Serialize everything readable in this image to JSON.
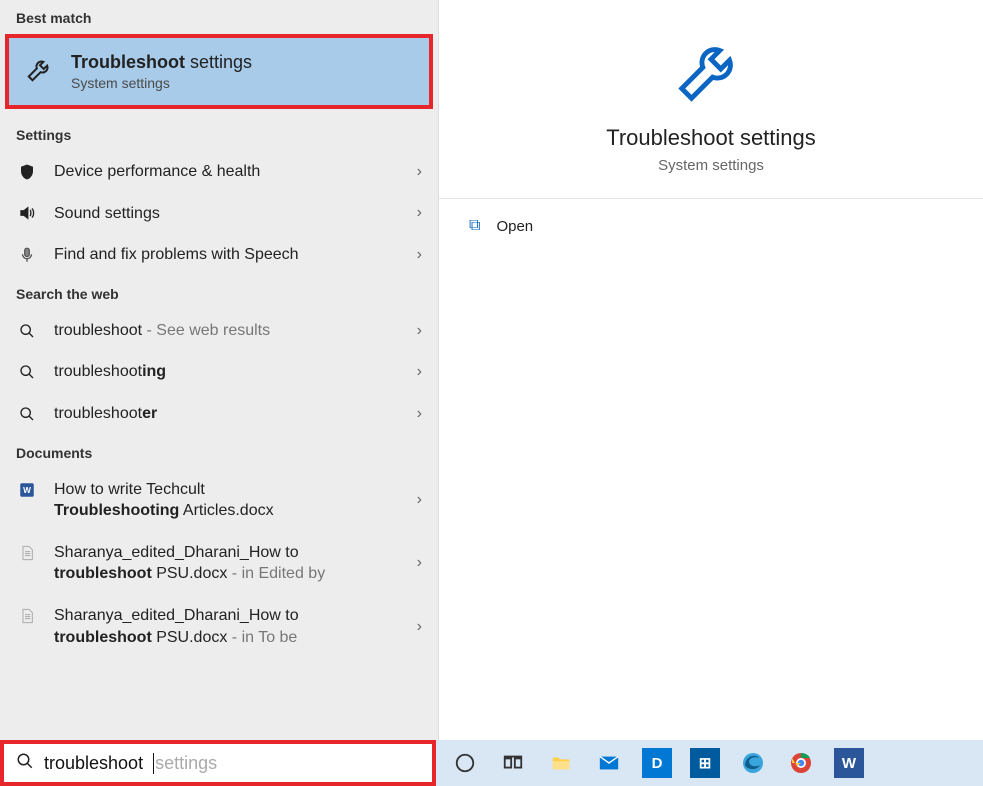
{
  "sections": {
    "best_match": "Best match",
    "settings": "Settings",
    "web": "Search the web",
    "documents": "Documents"
  },
  "best_match_item": {
    "title_bold": "Troubleshoot",
    "title_rest": " settings",
    "subtitle": "System settings"
  },
  "settings_items": [
    {
      "label": "Device performance & health"
    },
    {
      "label": "Sound settings"
    },
    {
      "label": "Find and fix problems with Speech"
    }
  ],
  "web_items": [
    {
      "prefix": "troubleshoot",
      "bold": "",
      "suffix": " - See web results",
      "suffix_faint": true
    },
    {
      "prefix": "troubleshoot",
      "bold": "ing",
      "suffix": ""
    },
    {
      "prefix": "troubleshoot",
      "bold": "er",
      "suffix": ""
    }
  ],
  "doc_items": [
    {
      "line1_pre": "How to write Techcult ",
      "line1_bold": "",
      "line2_bold": "Troubleshooting",
      "line2_post": " Articles.docx",
      "meta": ""
    },
    {
      "line1_pre": "Sharanya_edited_Dharani_How to ",
      "line1_bold": "",
      "line2_bold": "troubleshoot",
      "line2_post": " PSU.docx",
      "meta": " - in Edited by"
    },
    {
      "line1_pre": "Sharanya_edited_Dharani_How to ",
      "line1_bold": "",
      "line2_bold": "troubleshoot",
      "line2_post": " PSU.docx",
      "meta": " - in To be"
    }
  ],
  "preview": {
    "title": "Troubleshoot settings",
    "subtitle": "System settings",
    "open": "Open"
  },
  "search": {
    "typed": "troubleshoot",
    "ghost": " settings"
  },
  "taskbar_tiles": {
    "dell": "D",
    "store": "⊞",
    "word": "W"
  }
}
